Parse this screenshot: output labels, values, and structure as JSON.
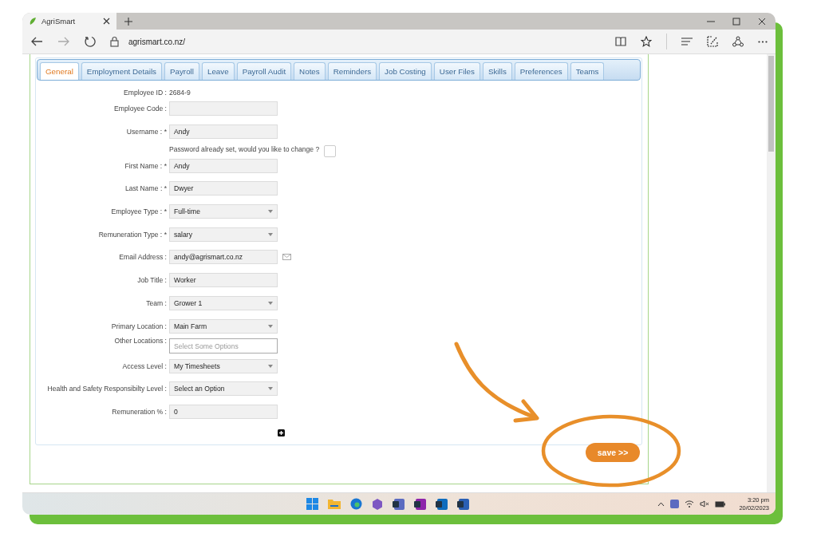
{
  "browser": {
    "tab_title": "AgriSmart",
    "url": "agrismart.co.nz/"
  },
  "tabs": [
    {
      "label": "General",
      "selected": true
    },
    {
      "label": "Employment Details",
      "selected": false
    },
    {
      "label": "Payroll",
      "selected": false
    },
    {
      "label": "Leave",
      "selected": false
    },
    {
      "label": "Payroll Audit",
      "selected": false
    },
    {
      "label": "Notes",
      "selected": false
    },
    {
      "label": "Reminders",
      "selected": false
    },
    {
      "label": "Job Costing",
      "selected": false
    },
    {
      "label": "User Files",
      "selected": false
    },
    {
      "label": "Skills",
      "selected": false
    },
    {
      "label": "Preferences",
      "selected": false
    },
    {
      "label": "Teams",
      "selected": false
    }
  ],
  "form": {
    "fields": [
      {
        "kind": "info",
        "label": "Employee ID :",
        "value": "2684-9"
      },
      {
        "kind": "text",
        "label": "Employee Code :"
      },
      {
        "kind": "text",
        "label": "Username : *",
        "value": "Andy"
      },
      {
        "kind": "checkbox",
        "text": "Password already set, would you like to change ?",
        "checked": false
      },
      {
        "kind": "text",
        "label": "First Name : *",
        "value": "Andy"
      },
      {
        "kind": "text",
        "label": "Last Name : *",
        "value": "Dwyer"
      },
      {
        "kind": "select",
        "label": "Employee Type : *",
        "value": "Full-time"
      },
      {
        "kind": "select",
        "label": "Remuneration Type : *",
        "value": "salary"
      },
      {
        "kind": "email",
        "label": "Email Address :",
        "value": "andy@agrismart.co.nz"
      },
      {
        "kind": "text",
        "label": "Job Title :",
        "value": "Worker"
      },
      {
        "kind": "select",
        "label": "Team :",
        "value": "Grower 1"
      },
      {
        "kind": "select",
        "label": "Primary Location :",
        "value": "Main Farm"
      },
      {
        "kind": "multiselect",
        "label": "Other Locations :",
        "placeholder": "Select Some Options"
      },
      {
        "kind": "select",
        "label": "Access Level :",
        "value": "My Timesheets"
      },
      {
        "kind": "select",
        "label": "Health and Safety Responsibilty Level :",
        "value": "Select an Option"
      },
      {
        "kind": "text",
        "label": "Remuneration % :",
        "value": "0"
      }
    ],
    "save_button": "save >>"
  },
  "taskbar": {
    "time": "3:20 pm",
    "date": "20/02/2023"
  }
}
